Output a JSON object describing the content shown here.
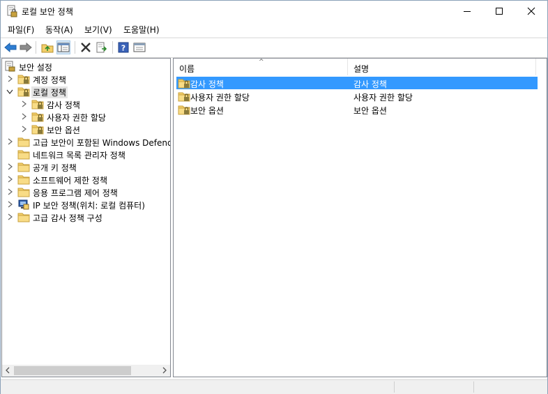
{
  "window": {
    "title": "로컬 보안 정책",
    "controls": [
      "minimize",
      "maximize",
      "close"
    ]
  },
  "menu": {
    "items": [
      {
        "label": "파일(F)"
      },
      {
        "label": "동작(A)"
      },
      {
        "label": "보기(V)"
      },
      {
        "label": "도움말(H)"
      }
    ]
  },
  "toolbar": {
    "buttons": [
      "back-arrow-icon",
      "forward-arrow-icon",
      "up-folder-icon",
      "show-hide-tree-icon",
      "delete-icon",
      "export-list-icon",
      "help-icon",
      "properties-icon"
    ]
  },
  "tree": {
    "root": {
      "label": "보안 설정"
    },
    "items": [
      {
        "label": "계정 정책",
        "expanded": false
      },
      {
        "label": "로컬 정책",
        "expanded": true,
        "selected": true
      },
      {
        "label": "감사 정책",
        "expanded": false
      },
      {
        "label": "사용자 권한 할당",
        "expanded": false
      },
      {
        "label": "보안 옵션",
        "expanded": false
      },
      {
        "label": "고급 보안이 포함된 Windows Defende",
        "expanded": false
      },
      {
        "label": "네트워크 목록 관리자 정책"
      },
      {
        "label": "공개 키 정책",
        "expanded": false
      },
      {
        "label": "소프트웨어 제한 정책",
        "expanded": false
      },
      {
        "label": "응용 프로그램 제어 정책",
        "expanded": false
      },
      {
        "label": "IP 보안 정책(위치: 로컬 컴퓨터)"
      },
      {
        "label": "고급 감사 정책 구성",
        "expanded": false
      }
    ]
  },
  "list": {
    "columns": [
      {
        "label": "이름"
      },
      {
        "label": "설명"
      }
    ],
    "rows": [
      {
        "name": "감사 정책",
        "description": "감사 정책",
        "selected": true
      },
      {
        "name": "사용자 권한 할당",
        "description": "사용자 권한 할당"
      },
      {
        "name": "보안 옵션",
        "description": "보안 옵션"
      }
    ]
  },
  "colors": {
    "selection": "#3399ff",
    "folder": "#e8c15a",
    "tree_selection": "#e5e5e5"
  }
}
